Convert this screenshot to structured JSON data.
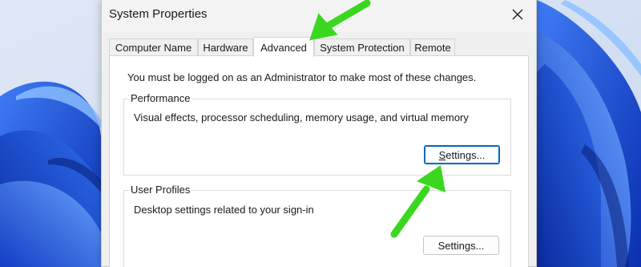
{
  "window": {
    "title": "System Properties",
    "close_icon": "close-icon"
  },
  "tabs": [
    {
      "label": "Computer Name",
      "active": false
    },
    {
      "label": "Hardware",
      "active": false
    },
    {
      "label": "Advanced",
      "active": true
    },
    {
      "label": "System Protection",
      "active": false
    },
    {
      "label": "Remote",
      "active": false
    }
  ],
  "advanced": {
    "admin_note": "You must be logged on as an Administrator to make most of these changes.",
    "performance": {
      "label": "Performance",
      "description": "Visual effects, processor scheduling, memory usage, and virtual memory",
      "button_label": "Settings..."
    },
    "user_profiles": {
      "label": "User Profiles",
      "description": "Desktop settings related to your sign-in",
      "button_label": "Settings..."
    }
  },
  "annotations": {
    "arrow_color": "#3bd71f"
  },
  "colors": {
    "wallpaper_blue": "#1f4fd6",
    "focus_blue": "#0067c0"
  }
}
